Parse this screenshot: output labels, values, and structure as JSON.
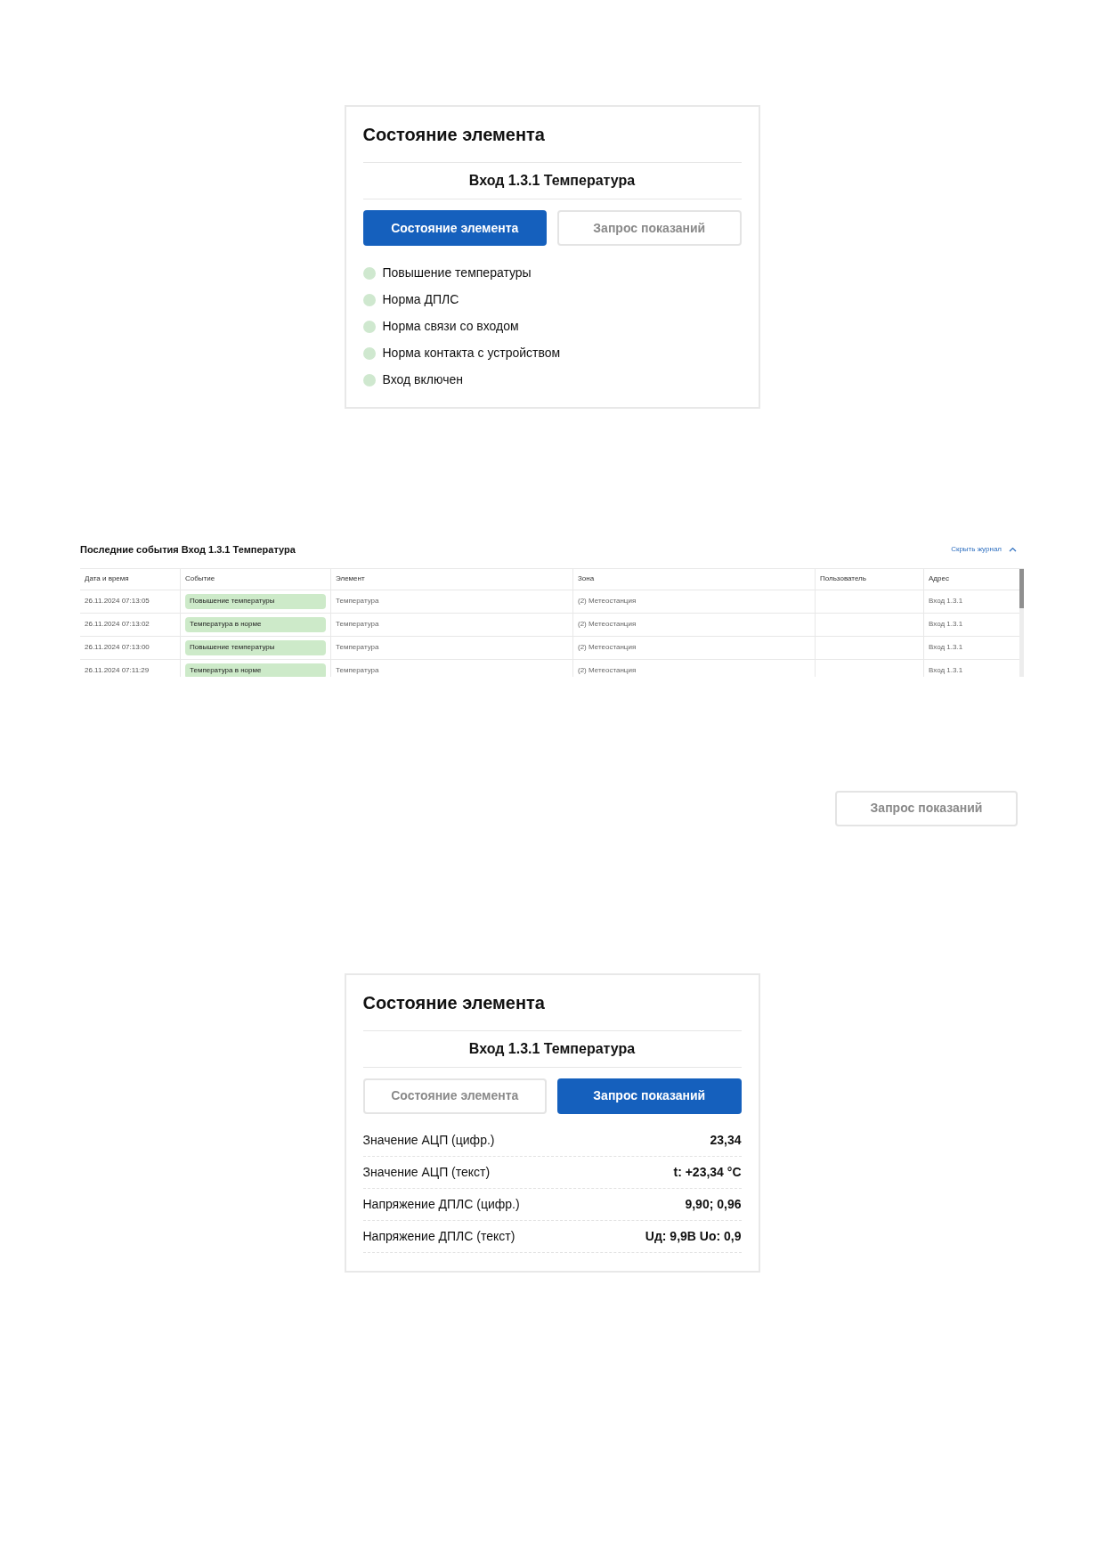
{
  "state_card": {
    "title": "Состояние элемента",
    "subtitle": "Вход 1.3.1 Температура",
    "tabs": [
      {
        "label": "Состояние элемента",
        "selected": true
      },
      {
        "label": "Запрос показаний",
        "selected": false
      }
    ],
    "statuses": [
      {
        "label": "Повышение температуры",
        "color": "#cfe8cf"
      },
      {
        "label": "Норма ДПЛС",
        "color": "#cfe8cf"
      },
      {
        "label": "Норма связи со входом",
        "color": "#cfe8cf"
      },
      {
        "label": "Норма контакта с устройством",
        "color": "#cfe8cf"
      },
      {
        "label": "Вход включен",
        "color": "#cfe8cf"
      }
    ]
  },
  "events": {
    "title": "Последние события Вход 1.3.1 Температура",
    "hide_link": "Скрыть журнал",
    "columns": [
      "Дата и время",
      "Событие",
      "Элемент",
      "Зона",
      "Пользователь",
      "Адрес"
    ],
    "rows": [
      {
        "datetime": "26.11.2024 07:13:05",
        "event": "Повышение температуры",
        "element": "Температура",
        "zone": "(2) Метеостанция",
        "address": "Вход 1.3.1"
      },
      {
        "datetime": "26.11.2024 07:13:02",
        "event": "Температура в норме",
        "element": "Температура",
        "zone": "(2) Метеостанция",
        "address": "Вход 1.3.1"
      },
      {
        "datetime": "26.11.2024 07:13:00",
        "event": "Повышение температуры",
        "element": "Температура",
        "zone": "(2) Метеостанция",
        "address": "Вход 1.3.1"
      },
      {
        "datetime": "26.11.2024 07:11:29",
        "event": "Температура в норме",
        "element": "Температура",
        "zone": "(2) Метеостанция",
        "address": "Вход 1.3.1"
      }
    ]
  },
  "request_button": {
    "label": "Запрос показаний"
  },
  "readings_card": {
    "title": "Состояние элемента",
    "subtitle": "Вход 1.3.1 Температура",
    "tabs": [
      {
        "label": "Состояние элемента",
        "selected": false
      },
      {
        "label": "Запрос показаний",
        "selected": true
      }
    ],
    "readings": [
      {
        "label": "Значение АЦП (цифр.)",
        "value": "23,34"
      },
      {
        "label": "Значение АЦП (текст)",
        "value": "t: +23,34 °C"
      },
      {
        "label": "Напряжение ДПЛС (цифр.)",
        "value": "9,90; 0,96"
      },
      {
        "label": "Напряжение ДПЛС (текст)",
        "value": "Uд: 9,9В Uо: 0,9"
      }
    ]
  }
}
